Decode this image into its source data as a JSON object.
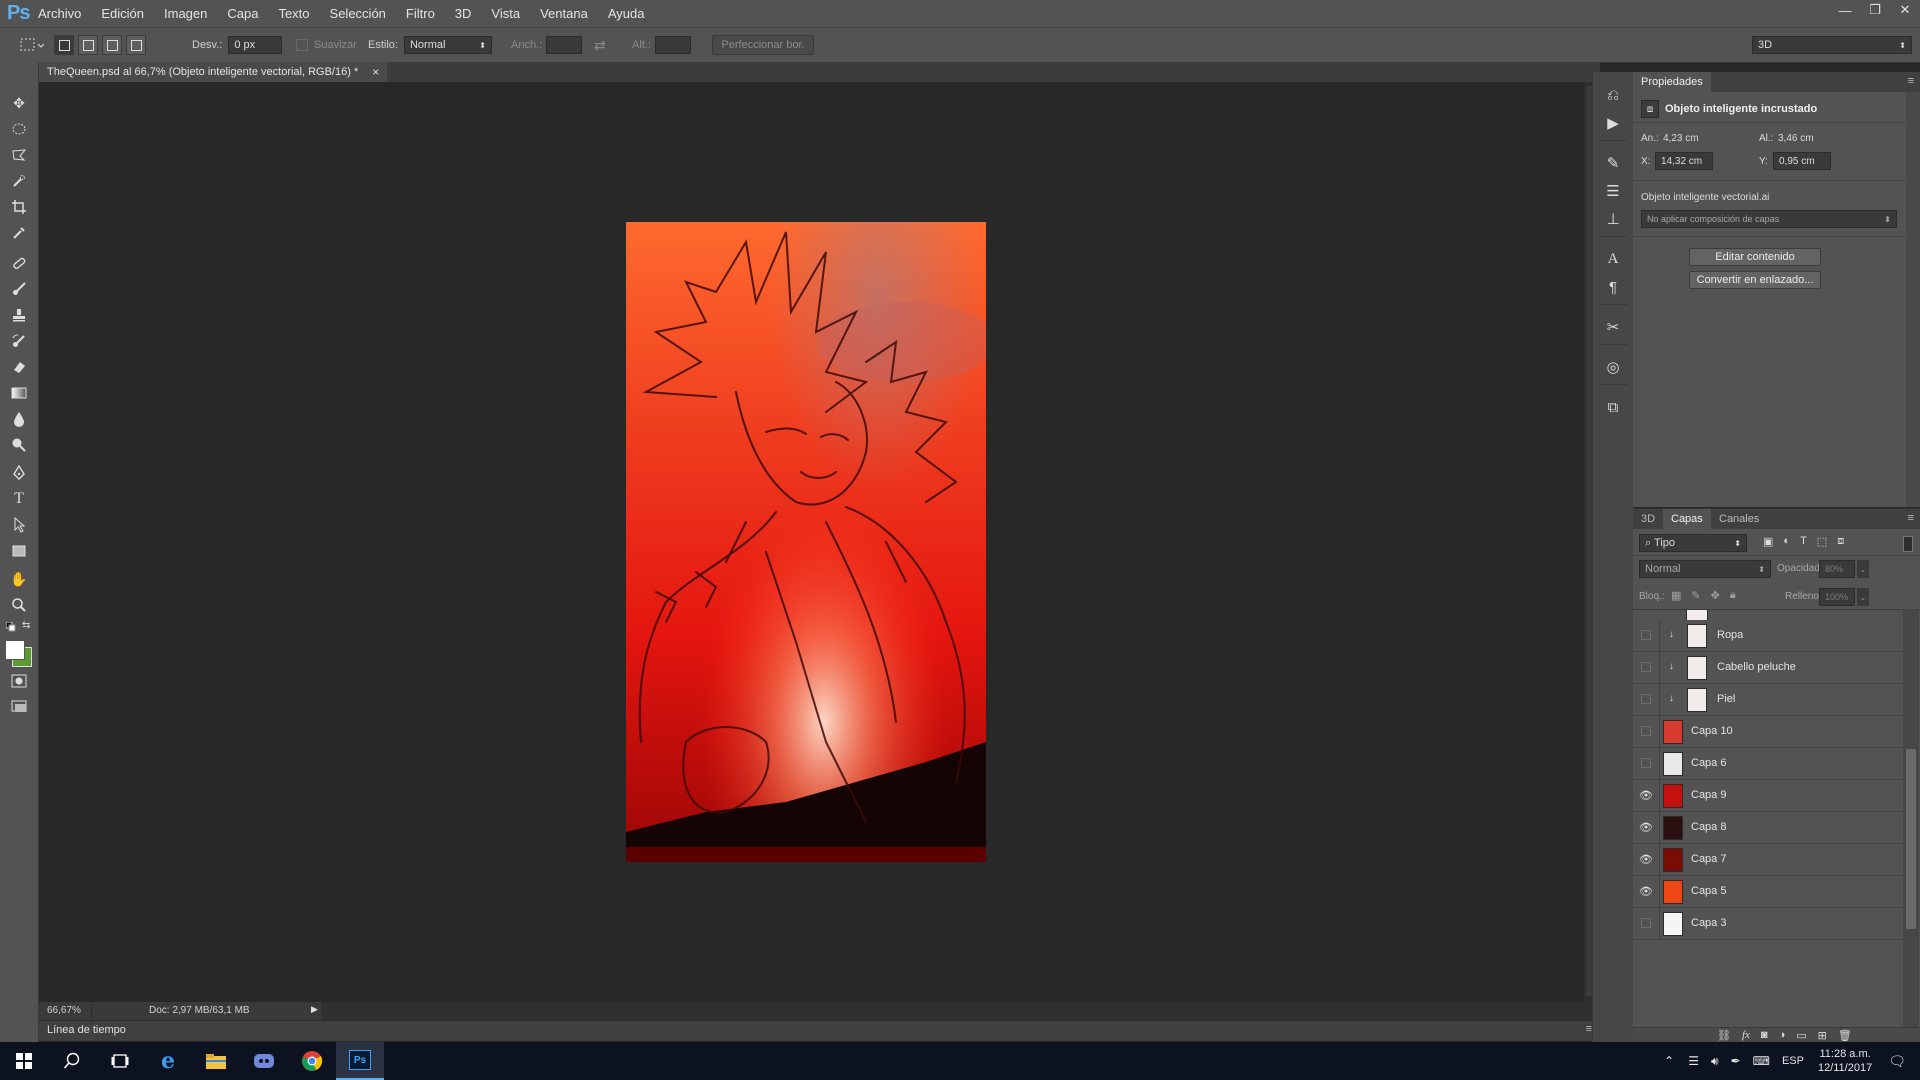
{
  "app": {
    "logo": "Ps"
  },
  "menu": [
    "Archivo",
    "Edición",
    "Imagen",
    "Capa",
    "Texto",
    "Selección",
    "Filtro",
    "3D",
    "Vista",
    "Ventana",
    "Ayuda"
  ],
  "window_controls": [
    "—",
    "❐",
    "✕"
  ],
  "options": {
    "feather_label": "Desv.:",
    "feather_value": "0 px",
    "antialias_label": "Suavizar",
    "style_label": "Estilo:",
    "style_value": "Normal",
    "width_label": "Anch.:",
    "height_label": "Alt.:",
    "refine_button": "Perfeccionar bor.",
    "workspace_value": "3D"
  },
  "document": {
    "tab_title": "TheQueen.psd al 66,7% (Objeto inteligente vectorial, RGB/16) *",
    "close_glyph": "×",
    "zoom": "66,67%",
    "doc_info": "Doc: 2,97 MB/63,1 MB"
  },
  "timeline": {
    "label": "Línea de tiempo"
  },
  "properties": {
    "tab": "Propiedades",
    "title": "Objeto inteligente incrustado",
    "width_label": "An.:",
    "width_value": "4,23 cm",
    "height_label": "Al.:",
    "height_value": "3,46 cm",
    "x_label": "X:",
    "x_value": "14,32 cm",
    "y_label": "Y:",
    "y_value": "0,95 cm",
    "file_name": "Objeto inteligente vectorial.ai",
    "comp_value": "No aplicar composición de capas",
    "edit_button": "Editar contenido",
    "convert_button": "Convertir en enlazado..."
  },
  "layers_panel": {
    "tabs": [
      "3D",
      "Capas",
      "Canales"
    ],
    "filter_value": "Tipo",
    "blend_value": "Normal",
    "opacity_label": "Opacidad:",
    "opacity_value": "80%",
    "lock_label": "Bloq.:",
    "fill_label": "Relleno:",
    "fill_value": "100%",
    "layers": [
      {
        "name": "Ropa",
        "visible": false,
        "clipped": true,
        "thumb": "#f3ecec"
      },
      {
        "name": "Cabello peluche",
        "visible": false,
        "clipped": true,
        "thumb": "#f3ecec"
      },
      {
        "name": "Piel",
        "visible": false,
        "clipped": true,
        "thumb": "#f3ecec"
      },
      {
        "name": "Capa 10",
        "visible": false,
        "clipped": false,
        "thumb": "#d73a2e"
      },
      {
        "name": "Capa 6",
        "visible": false,
        "clipped": false,
        "thumb": "#e9e9e9"
      },
      {
        "name": "Capa 9",
        "visible": true,
        "clipped": false,
        "thumb": "#c3120f"
      },
      {
        "name": "Capa 8",
        "visible": true,
        "clipped": false,
        "thumb": "#2a1010"
      },
      {
        "name": "Capa 7",
        "visible": true,
        "clipped": false,
        "thumb": "#7a0c06"
      },
      {
        "name": "Capa 5",
        "visible": true,
        "clipped": false,
        "thumb": "#f04716"
      },
      {
        "name": "Capa 3",
        "visible": false,
        "clipped": false,
        "thumb": "#f5f5f5"
      }
    ]
  },
  "taskbar": {
    "language": "ESP",
    "time": "11:28 a.m.",
    "date": "12/11/2017"
  }
}
